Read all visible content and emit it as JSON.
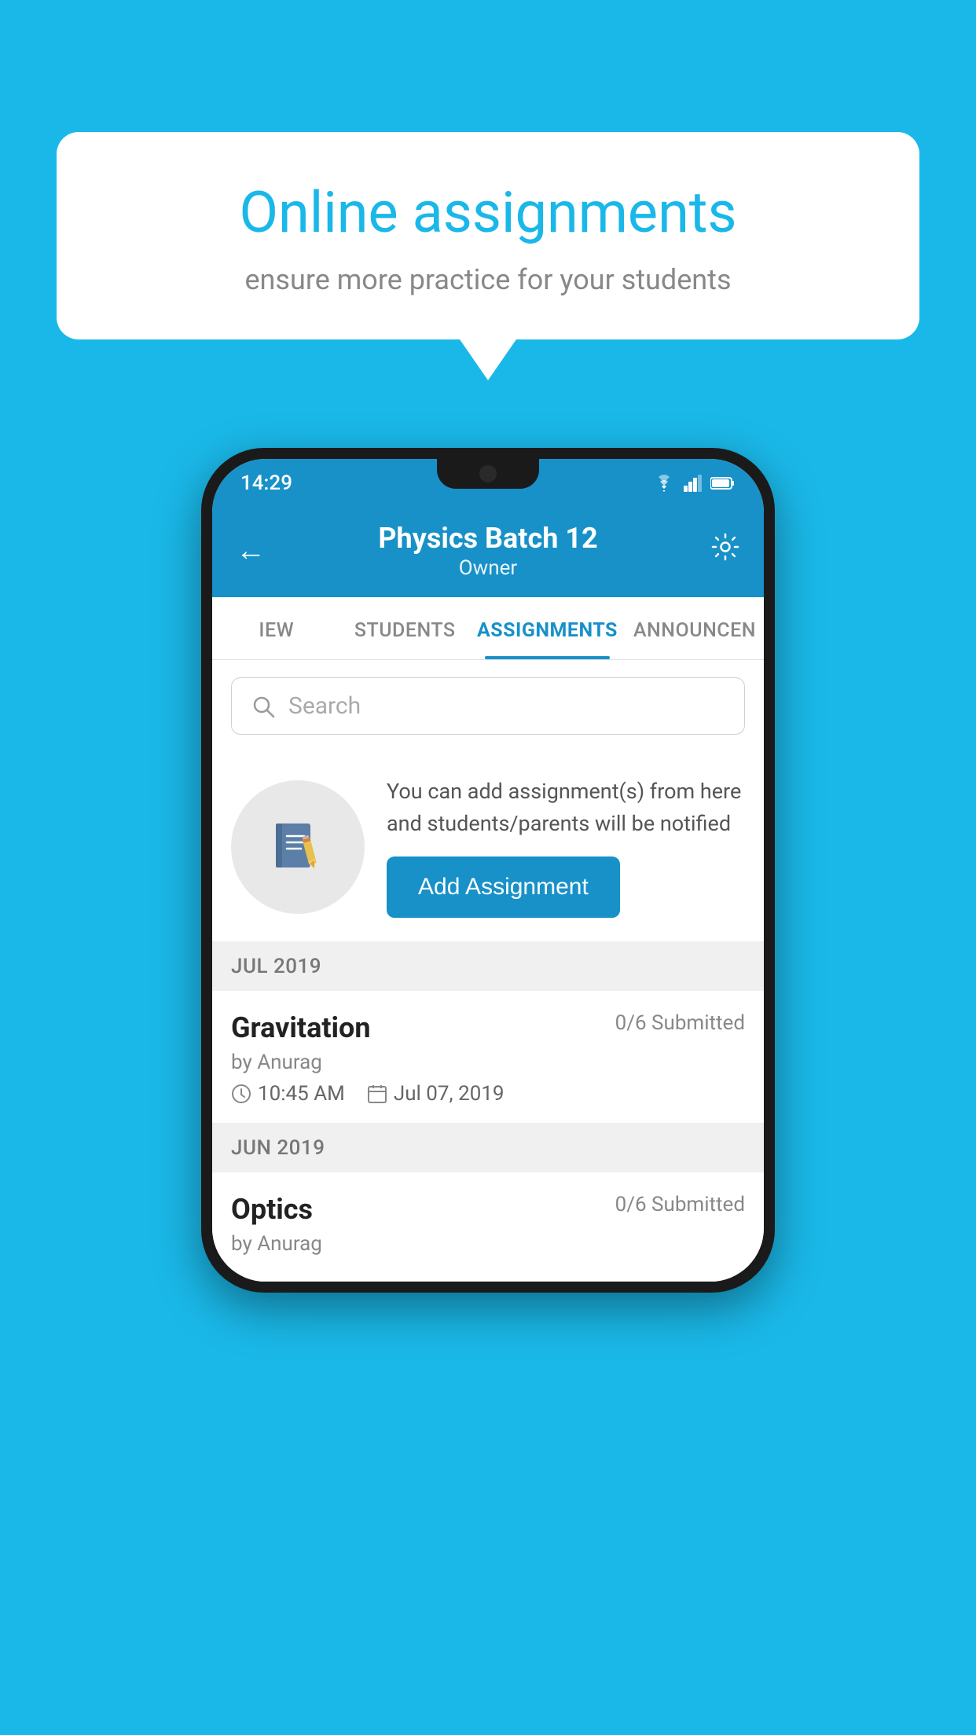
{
  "background": {
    "color": "#1ab8e8"
  },
  "speech_bubble": {
    "title": "Online assignments",
    "subtitle": "ensure more practice for your students"
  },
  "phone": {
    "status_bar": {
      "time": "14:29",
      "icons": [
        "wifi",
        "signal",
        "battery"
      ]
    },
    "header": {
      "title": "Physics Batch 12",
      "subtitle": "Owner",
      "back_label": "←",
      "settings_label": "⚙"
    },
    "tabs": [
      {
        "label": "IEW",
        "active": false
      },
      {
        "label": "STUDENTS",
        "active": false
      },
      {
        "label": "ASSIGNMENTS",
        "active": true
      },
      {
        "label": "ANNOUNCEN",
        "active": false
      }
    ],
    "search": {
      "placeholder": "Search"
    },
    "promo": {
      "icon_label": "notebook-pencil",
      "text": "You can add assignment(s) from here and students/parents will be notified",
      "button_label": "Add Assignment"
    },
    "assignments": {
      "sections": [
        {
          "month_label": "JUL 2019",
          "items": [
            {
              "title": "Gravitation",
              "submitted": "0/6 Submitted",
              "by": "by Anurag",
              "time": "10:45 AM",
              "date": "Jul 07, 2019"
            }
          ]
        },
        {
          "month_label": "JUN 2019",
          "items": [
            {
              "title": "Optics",
              "submitted": "0/6 Submitted",
              "by": "by Anurag",
              "time": "",
              "date": ""
            }
          ]
        }
      ]
    }
  }
}
